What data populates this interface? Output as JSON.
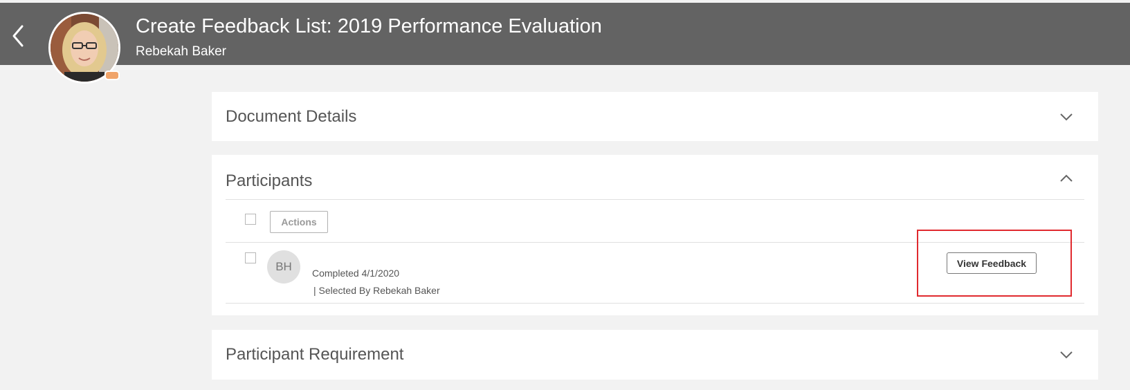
{
  "header": {
    "title": "Create Feedback List: 2019 Performance Evaluation",
    "subtitle": "Rebekah Baker",
    "back_icon": "chevron-left-icon",
    "avatar": "profile-photo",
    "colors": {
      "bar": "#636363",
      "text": "#ffffff"
    }
  },
  "sections": {
    "document_details": {
      "title": "Document Details",
      "icon": "chevron-down-icon"
    },
    "participants": {
      "title": "Participants",
      "icon": "chevron-up-icon",
      "toolbar": {
        "actions_label": "Actions"
      },
      "rows": [
        {
          "initials": "BH",
          "status": "Completed 4/1/2020",
          "selected_by": "| Selected By Rebekah Baker",
          "button_label": "View Feedback"
        }
      ]
    },
    "participant_requirement": {
      "title": "Participant Requirement",
      "icon": "chevron-down-icon"
    }
  },
  "highlight_color": "#e0292e"
}
